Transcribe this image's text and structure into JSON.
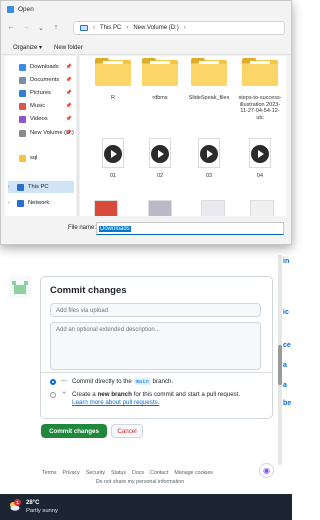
{
  "dialog": {
    "title": "Open",
    "nav": {
      "back": "←",
      "forward": "→",
      "up_history": "⌄",
      "up": "↑"
    },
    "breadcrumb": [
      "This PC",
      "New Volume (D:)"
    ],
    "breadcrumb_sep": "›",
    "toolbar": {
      "organize": "Organize ▾",
      "new_folder": "New folder"
    },
    "sidebar": [
      {
        "label": "Downloads",
        "icon": "download-icon",
        "color": "#3b8be0",
        "pinned": true
      },
      {
        "label": "Documents",
        "icon": "documents-icon",
        "color": "#7a8fa6",
        "pinned": true
      },
      {
        "label": "Pictures",
        "icon": "pictures-icon",
        "color": "#2f7fd6",
        "pinned": true
      },
      {
        "label": "Music",
        "icon": "music-icon",
        "color": "#e0544b",
        "pinned": true
      },
      {
        "label": "Videos",
        "icon": "videos-icon",
        "color": "#8a57c5",
        "pinned": true
      },
      {
        "label": "New Volume (D:)",
        "icon": "drive-icon",
        "color": "#8a8a8a",
        "pinned": true
      },
      {
        "label": "sql",
        "icon": "folder-icon",
        "color": "#f4c542",
        "pinned": false
      },
      {
        "label": "This PC",
        "icon": "this-pc-icon",
        "color": "#2a6fc9",
        "pinned": false,
        "selected": true,
        "chevron": "›"
      },
      {
        "label": "Network",
        "icon": "network-icon",
        "color": "#2a6fc9",
        "pinned": false,
        "chevron": "›"
      }
    ],
    "pin_glyph": "📌",
    "files_row1": [
      {
        "name": "R",
        "kind": "folder"
      },
      {
        "name": "rdbms",
        "kind": "folder"
      },
      {
        "name": "SlideSpeak_files",
        "kind": "folder"
      },
      {
        "name": "steps-to-success-illustration 2023-11-27-04-54-12-utc",
        "kind": "folder"
      }
    ],
    "files_row2": [
      {
        "name": "01",
        "kind": "video"
      },
      {
        "name": "02",
        "kind": "video"
      },
      {
        "name": "03",
        "kind": "video"
      },
      {
        "name": "04",
        "kind": "video"
      }
    ],
    "file_name_label": "File name:",
    "file_name_value": "Downloads"
  },
  "github": {
    "commit_title": "Commit changes",
    "summary_placeholder": "Add files via upload",
    "description_placeholder": "Add an optional extended description...",
    "option_direct_prefix": "Commit directly to the",
    "branch": "main",
    "option_direct_suffix": "branch.",
    "option_new_branch_prefix": "Create a",
    "option_new_branch_bold": "new branch",
    "option_new_branch_suffix": "for this commit and start a pull request.",
    "learn_more": "Learn more about pull requests.",
    "commit_button": "Commit changes",
    "cancel_button": "Cancel",
    "footer_links": [
      "Terms",
      "Privacy",
      "Security",
      "Status",
      "Docs",
      "Contact",
      "Manage cookies"
    ],
    "footer_line2": "Do not share my personal information",
    "side_fragments": [
      "in",
      "ic",
      "ce",
      "a",
      "a",
      "be"
    ],
    "accent_green": "#1f883d",
    "accent_blue": "#0969da"
  },
  "taskbar": {
    "badge": "1",
    "temperature": "28°C",
    "condition": "Partly sunny"
  }
}
